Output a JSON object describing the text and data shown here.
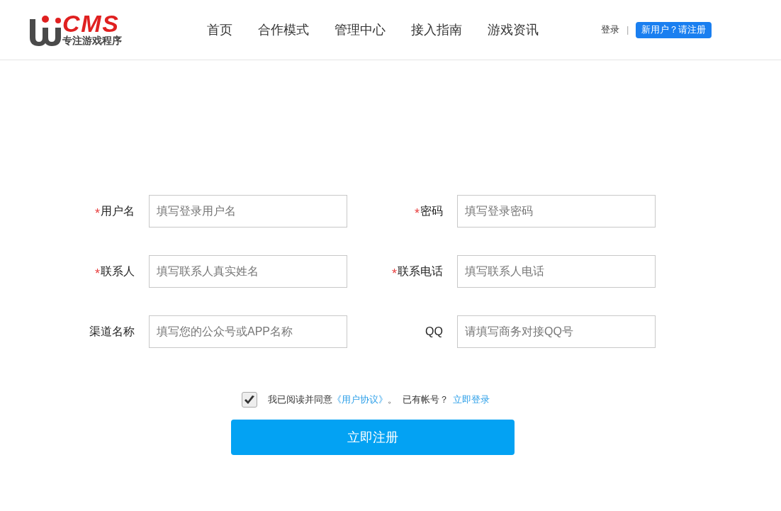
{
  "logo": {
    "wordmark": "CMS",
    "tagline": "专注游戏程序"
  },
  "nav": [
    {
      "label": "首页"
    },
    {
      "label": "合作模式"
    },
    {
      "label": "管理中心"
    },
    {
      "label": "接入指南"
    },
    {
      "label": "游戏资讯"
    }
  ],
  "auth": {
    "login": "登录",
    "separator": "|",
    "register": "新用户？请注册"
  },
  "fields": [
    {
      "label": "用户名",
      "required": true,
      "placeholder": "填写登录用户名"
    },
    {
      "label": "密码",
      "required": true,
      "placeholder": "填写登录密码"
    },
    {
      "label": "联系人",
      "required": true,
      "placeholder": "填写联系人真实姓名"
    },
    {
      "label": "联系电话",
      "required": true,
      "placeholder": "填写联系人电话"
    },
    {
      "label": "渠道名称",
      "required": false,
      "placeholder": "填写您的公众号或APP名称"
    },
    {
      "label": "QQ",
      "required": false,
      "placeholder": "请填写商务对接QQ号"
    }
  ],
  "required_mark": "*",
  "agreement": {
    "checked": true,
    "text": "我已阅读并同意",
    "link": "《用户协议》",
    "period": "。",
    "has_account": "已有帐号？",
    "login_link": "立即登录"
  },
  "submit": "立即注册"
}
